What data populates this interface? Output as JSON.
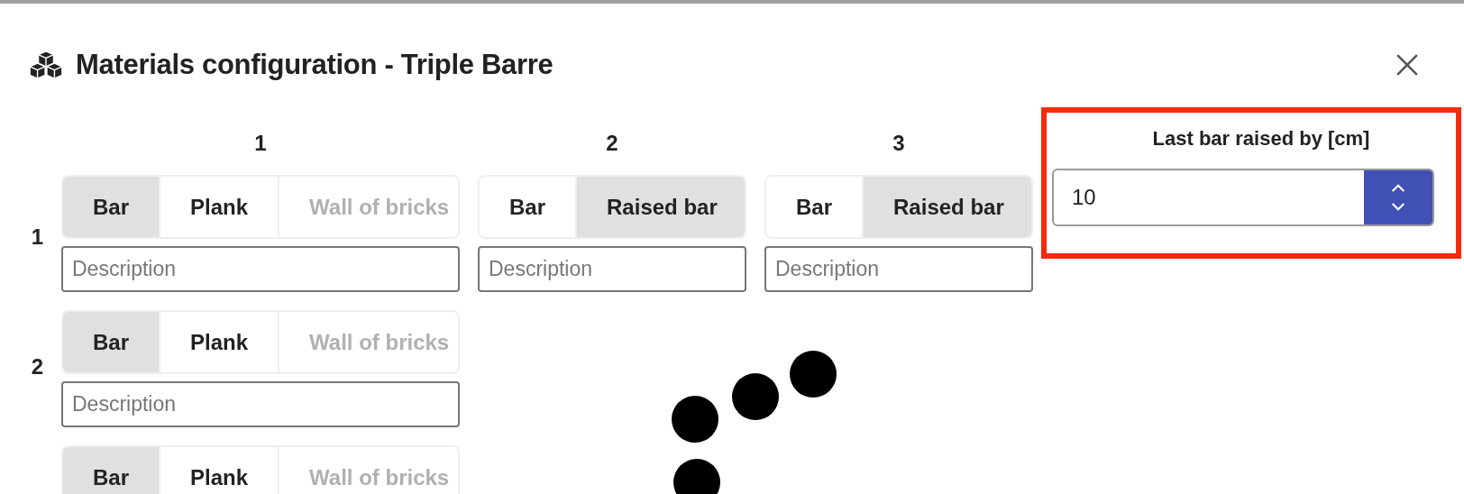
{
  "dialog": {
    "title": "Materials configuration - Triple Barre"
  },
  "columns": [
    "1",
    "2",
    "3"
  ],
  "raised_field": {
    "label": "Last bar raised by [cm]",
    "value": "10",
    "highlighted": true
  },
  "rows": [
    {
      "label": "1",
      "cells": [
        {
          "options": [
            {
              "label": "Bar",
              "selected": true,
              "disabled": false
            },
            {
              "label": "Plank",
              "selected": false,
              "disabled": false
            },
            {
              "label": "Wall of bricks",
              "selected": false,
              "disabled": true
            }
          ],
          "placeholder": "Description"
        },
        {
          "options": [
            {
              "label": "Bar",
              "selected": false,
              "disabled": false
            },
            {
              "label": "Raised bar",
              "selected": true,
              "disabled": false
            }
          ],
          "placeholder": "Description"
        },
        {
          "options": [
            {
              "label": "Bar",
              "selected": false,
              "disabled": false
            },
            {
              "label": "Raised bar",
              "selected": true,
              "disabled": false
            }
          ],
          "placeholder": "Description"
        }
      ]
    },
    {
      "label": "2",
      "cells": [
        {
          "options": [
            {
              "label": "Bar",
              "selected": true,
              "disabled": false
            },
            {
              "label": "Plank",
              "selected": false,
              "disabled": false
            },
            {
              "label": "Wall of bricks",
              "selected": false,
              "disabled": true
            }
          ],
          "placeholder": "Description"
        }
      ]
    },
    {
      "cells": [
        {
          "options": [
            {
              "label": "Bar",
              "selected": true,
              "disabled": false
            },
            {
              "label": "Plank",
              "selected": false,
              "disabled": false
            },
            {
              "label": "Wall of bricks",
              "selected": false,
              "disabled": true
            }
          ]
        }
      ]
    }
  ],
  "loading": true
}
